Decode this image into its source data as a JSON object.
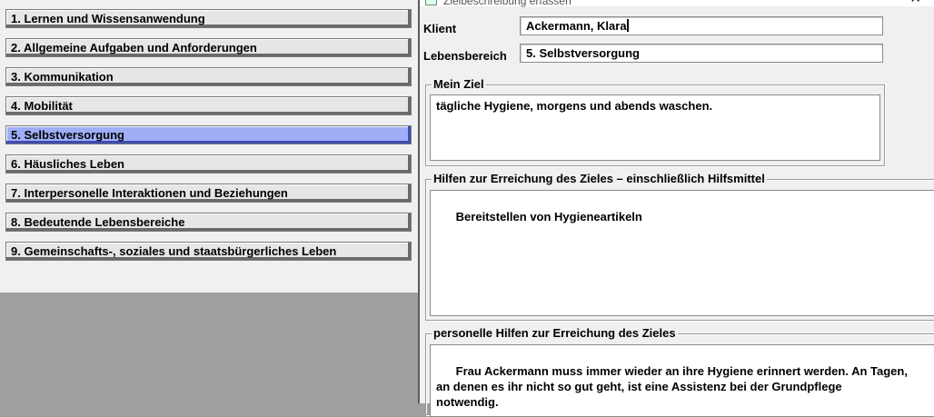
{
  "dialog": {
    "title": "Zielbeschreibung erfassen",
    "close_glyph": "✕"
  },
  "categories": [
    {
      "label": "1. Lernen und Wissensanwendung",
      "selected": false
    },
    {
      "label": "2. Allgemeine Aufgaben und Anforderungen",
      "selected": false
    },
    {
      "label": "3. Kommunikation",
      "selected": false
    },
    {
      "label": "4. Mobilität",
      "selected": false
    },
    {
      "label": "5. Selbstversorgung",
      "selected": true
    },
    {
      "label": "6. Häusliches Leben",
      "selected": false
    },
    {
      "label": "7. Interpersonelle Interaktionen und Beziehungen",
      "selected": false
    },
    {
      "label": "8. Bedeutende Lebensbereiche",
      "selected": false
    },
    {
      "label": "9. Gemeinschafts-, soziales und staatsbürgerliches Leben",
      "selected": false
    }
  ],
  "form": {
    "klient_label": "Klient",
    "klient_value": "Ackermann, Klara",
    "lebensbereich_label": "Lebensbereich",
    "lebensbereich_value": "5. Selbstversorgung",
    "mein_ziel_legend": "Mein Ziel",
    "mein_ziel_text": "tägliche Hygiene, morgens und abends waschen.",
    "hilfen_legend": "Hilfen zur Erreichung des Zieles – einschließlich Hilfsmittel",
    "hilfen_text": "Bereitstellen von Hygieneartikeln",
    "personelle_legend": "personelle Hilfen zur Erreichung des Zieles",
    "personelle_text": "Frau Ackermann muss immer wieder an ihre Hygiene erinnert werden. An Tagen,\nan denen es ihr nicht so gut geht, ist eine Assistenz bei der Grundpflege\nnotwendig."
  },
  "colors": {
    "selected_bg": "#9eaef7",
    "button_bg": "#e6e6e6",
    "background_gray": "#a0a0a0"
  }
}
